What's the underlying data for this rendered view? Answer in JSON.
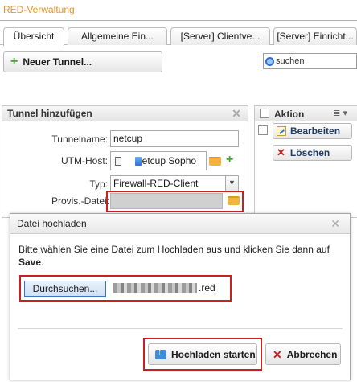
{
  "app": {
    "title": "RED-Verwaltung"
  },
  "tabs": [
    {
      "label": "Übersicht"
    },
    {
      "label": "Allgemeine Ein..."
    },
    {
      "label": "[Server] Clientve..."
    },
    {
      "label": "[Server] Einricht..."
    }
  ],
  "toolbar": {
    "new_tunnel_label": "Neuer Tunnel...",
    "search_placeholder": "suchen"
  },
  "tunnel_panel": {
    "title": "Tunnel hinzufügen",
    "tunnelname_label": "Tunnelname:",
    "tunnelname_value": "netcup",
    "utm_host_label": "UTM-Host:",
    "utm_host_value": "Netcup Sopho",
    "typ_label": "Typ:",
    "typ_value": "Firewall-RED-Client",
    "provis_label": "Provis.-Datei:"
  },
  "grid": {
    "column_label": "Aktion",
    "edit_label": "Bearbeiten",
    "delete_label": "Löschen"
  },
  "dialog": {
    "title": "Datei hochladen",
    "message": "Bitte wählen Sie eine Datei zum Hochladen aus und klicken Sie dann auf",
    "message_strong": "Save",
    "browse_label": "Durchsuchen...",
    "file_ext": ".red",
    "upload_label": "Hochladen starten",
    "cancel_label": "Abbrechen"
  },
  "colors": {
    "title_orange": "#e8932b",
    "highlight_red": "#cc1f1f",
    "accent_blue": "#2d6fd8"
  }
}
